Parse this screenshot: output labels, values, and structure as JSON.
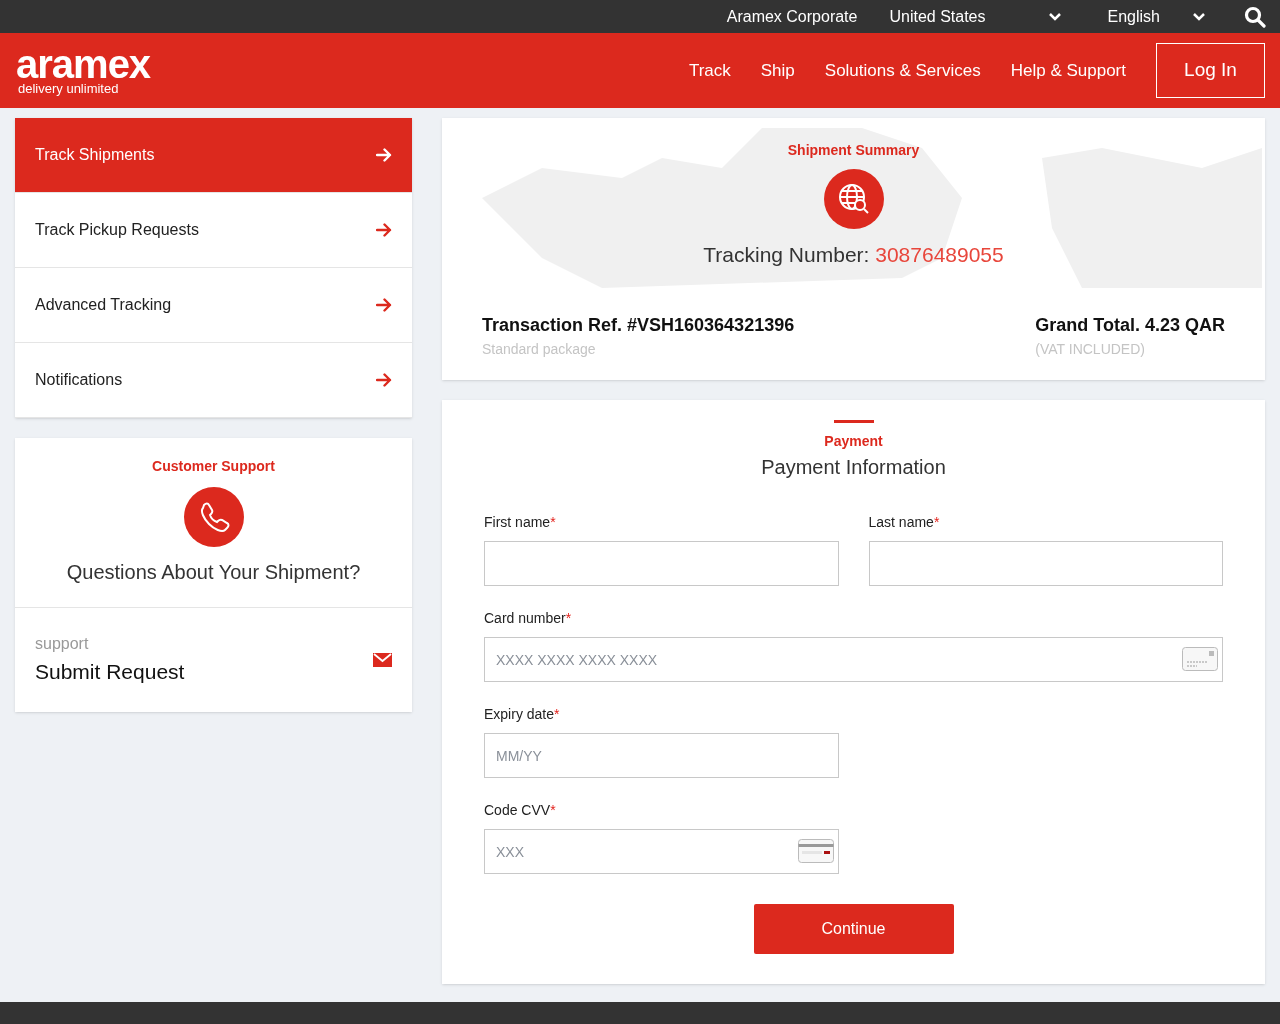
{
  "top_bar": {
    "links": [
      "Aramex Corporate"
    ],
    "country": "United States",
    "language": "English"
  },
  "header": {
    "logo": "aramex",
    "tagline": "delivery unlimited",
    "nav": [
      "Track",
      "Ship",
      "Solutions & Services",
      "Help & Support"
    ],
    "login": "Log In"
  },
  "sidebar": {
    "items": [
      {
        "label": "Track Shipments",
        "selected": true
      },
      {
        "label": "Track Pickup Requests",
        "selected": false
      },
      {
        "label": "Advanced Tracking",
        "selected": false
      },
      {
        "label": "Notifications",
        "selected": false
      }
    ]
  },
  "support": {
    "title": "Customer Support",
    "question": "Questions About Your Shipment?",
    "label": "support",
    "link": "Submit Request"
  },
  "summary": {
    "title": "Shipment Summary",
    "tracking_label": "Tracking Number:",
    "tracking_number": "30876489055",
    "transaction": "Transaction Ref. #VSH160364321396",
    "package": "Standard package",
    "total": "Grand Total. 4.23 QAR",
    "vat": "(VAT INCLUDED)"
  },
  "payment": {
    "step": "Payment",
    "title": "Payment Information",
    "fields": [
      {
        "kind": "text",
        "label": "First name",
        "required_mark": "*"
      },
      {
        "kind": "text",
        "label": "Last name",
        "required_mark": "*"
      },
      {
        "kind": "card",
        "label": "Card number",
        "required_mark": "*",
        "placeholder": "XXXX XXXX XXXX XXXX"
      },
      {
        "kind": "short",
        "label": "Expiry date",
        "required_mark": "*",
        "placeholder": "MM/YY"
      },
      {
        "kind": "cvv",
        "label": "Code CVV",
        "required_mark": "*",
        "placeholder": "XXX"
      }
    ],
    "button": "Continue"
  }
}
